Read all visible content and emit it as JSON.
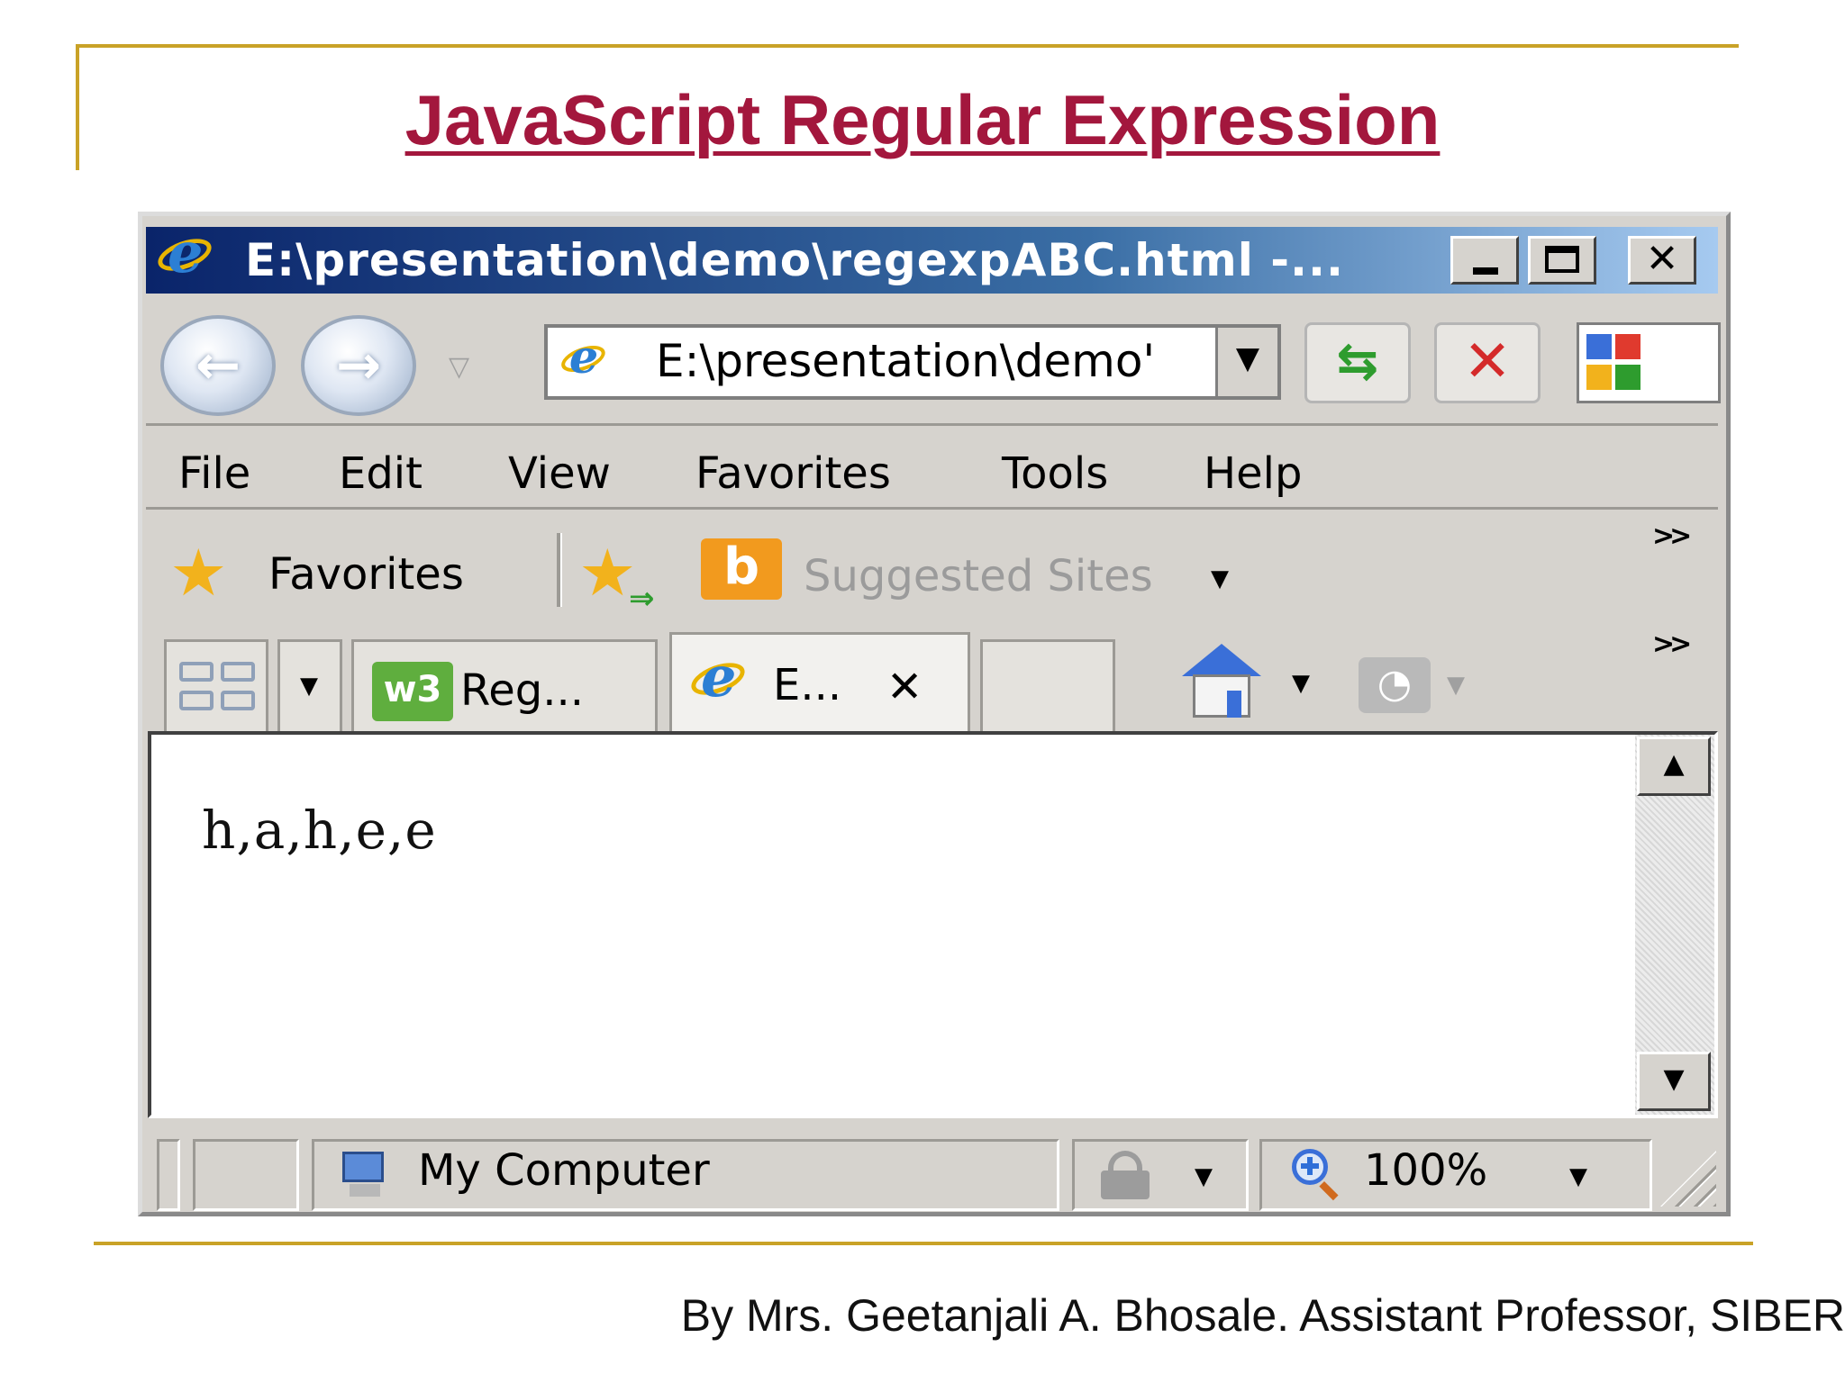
{
  "slide": {
    "title": "JavaScript Regular Expression",
    "footer": "By Mrs. Geetanjali A. Bhosale. Assistant Professor, SIBER"
  },
  "browser": {
    "title_bar": "E:\\presentation\\demo\\regexpABC.html -...",
    "address": "E:\\presentation\\demo'",
    "menu": [
      "File",
      "Edit",
      "View",
      "Favorites",
      "Tools",
      "Help"
    ],
    "favorites_label": "Favorites",
    "suggested_sites": "Suggested Sites",
    "tabs": [
      {
        "label": "Reg...",
        "active": false
      },
      {
        "label": "E...",
        "active": true
      }
    ],
    "page_output": "h,a,h,e,e",
    "status": {
      "zone": "My Computer",
      "zoom": "100%"
    },
    "icons": [
      "ie-logo-icon",
      "back-icon",
      "forward-icon",
      "refresh-icon",
      "stop-icon",
      "google-icon",
      "star-icon",
      "add-favorite-icon",
      "bing-icon",
      "quick-tabs-icon",
      "w3schools-icon",
      "home-icon",
      "rss-icon",
      "computer-icon",
      "lock-icon",
      "zoom-icon"
    ],
    "colors": {
      "title_red": "#A3173D",
      "gold_rule": "#C9A227",
      "titlebar_start": "#0A246A",
      "titlebar_end": "#A6CAF0",
      "chrome_gray": "#D6D3CE"
    }
  }
}
